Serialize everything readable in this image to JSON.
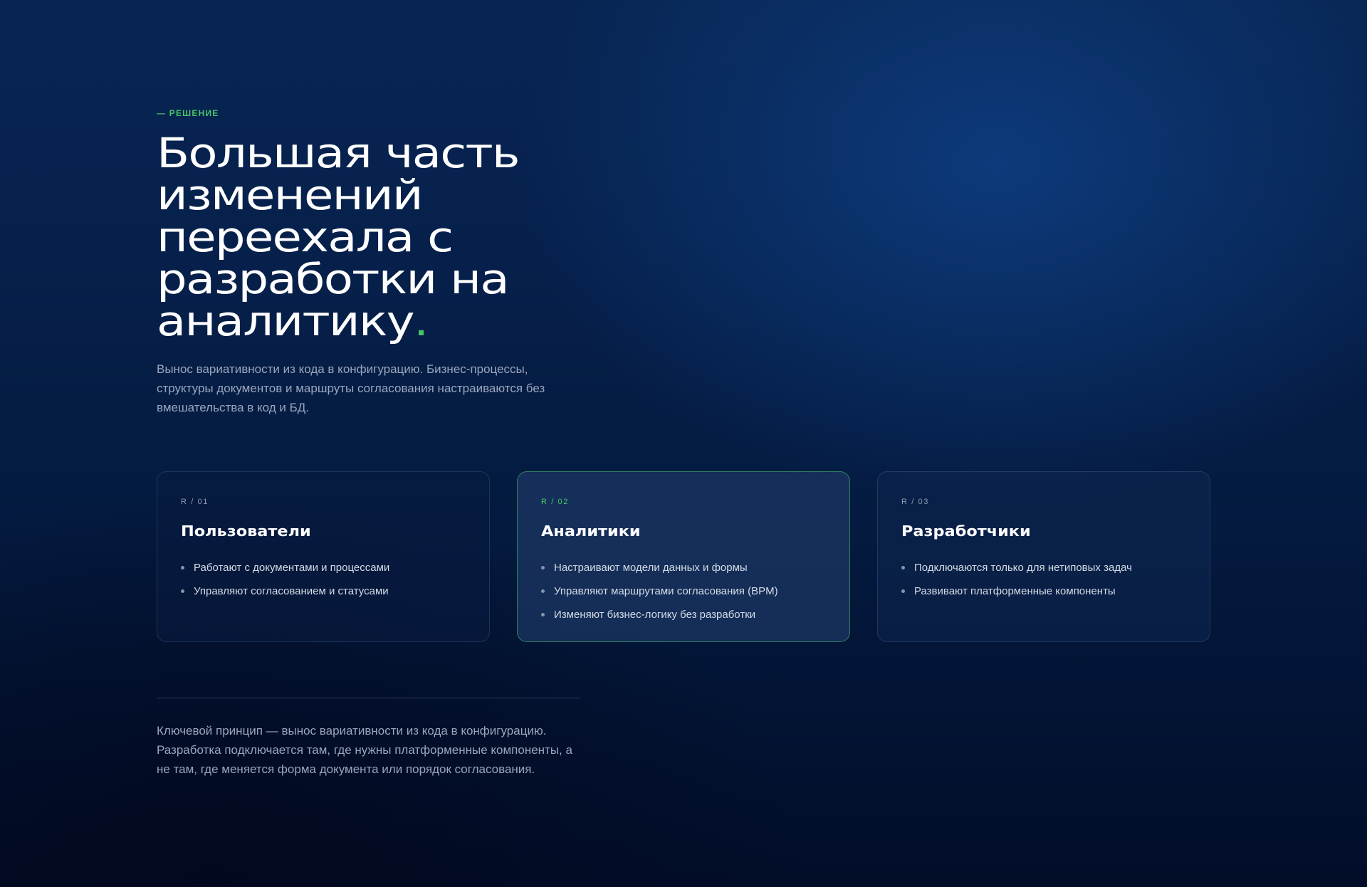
{
  "section": {
    "eyebrow": "— РЕШЕНИЕ",
    "headline_lines": [
      "Большая часть",
      "изменений",
      "переехала с",
      "разработки на",
      "аналитику"
    ],
    "headline_dot": ".",
    "lead": "Вынос вариативности из кода в конфигурацию. Бизнес-процессы, структуры документов и маршруты согласования настраиваются без вмешательства в код и БД."
  },
  "cards": [
    {
      "tag": "R / 01",
      "title": "Пользователи",
      "items": [
        "Работают с документами и процессами",
        "Управляют согласованием и статусами"
      ]
    },
    {
      "tag": "R / 02",
      "title": "Аналитики",
      "items": [
        "Настраивают модели данных и формы",
        "Управляют маршрутами согласования (BPM)",
        "Изменяют бизнес-логику без разработки"
      ]
    },
    {
      "tag": "R / 03",
      "title": "Разработчики",
      "items": [
        "Подключаются только для нетиповых задач",
        "Развивают платформенные компоненты"
      ]
    }
  ],
  "footnote": "Ключевой принцип — вынос вариативности из кода в конфигурацию. Разработка подключается там, где нужны платформенные компоненты, а не там, где меняется форма документа или порядок согласования.",
  "colors": {
    "accent": "#47c468",
    "background": "#06204b",
    "text_muted": "#9aa6bd"
  }
}
